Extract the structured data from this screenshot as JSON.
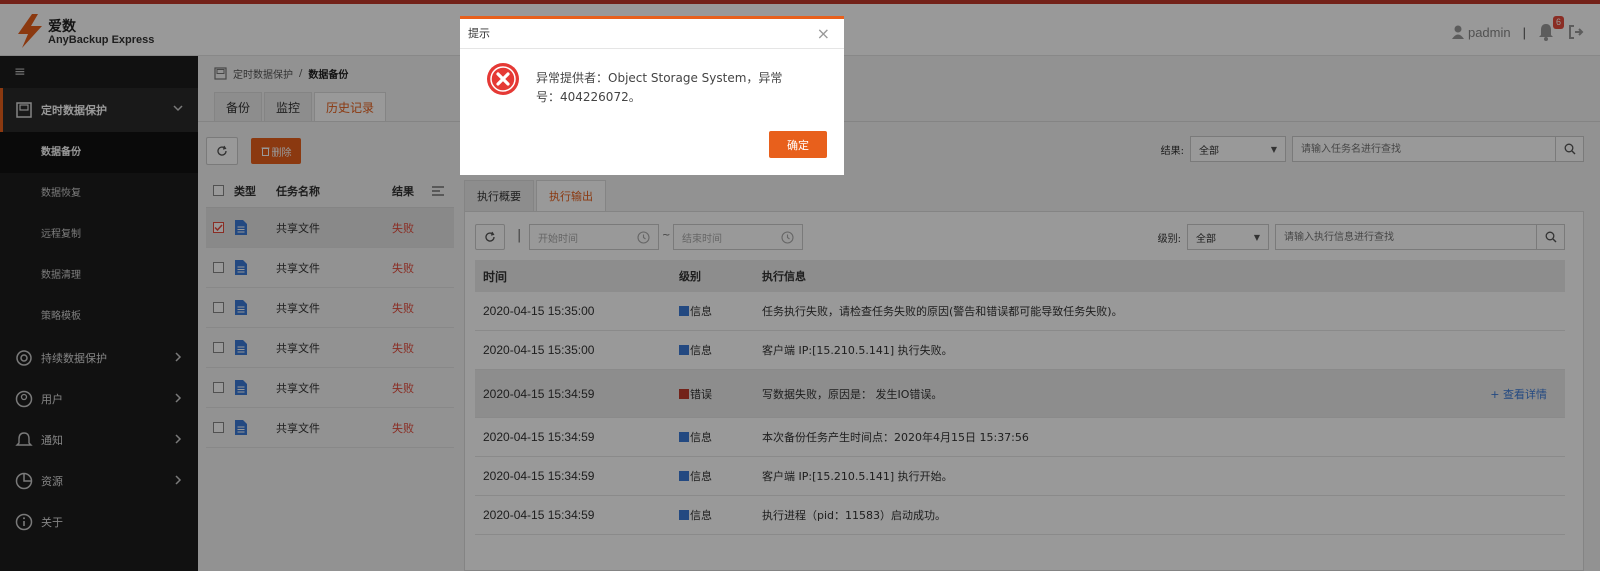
{
  "header": {
    "brand_cn": "爱数",
    "brand_en": "AnyBackup Express",
    "username": "padmin",
    "separator": "|",
    "notification_count": "6"
  },
  "sidebar": {
    "active_group": {
      "label": "定时数据保护",
      "icon": "backup-icon"
    },
    "sub_items": [
      {
        "label": "数据备份",
        "active": true
      },
      {
        "label": "数据恢复"
      },
      {
        "label": "远程复制"
      },
      {
        "label": "数据清理"
      },
      {
        "label": "策略模板"
      }
    ],
    "groups": [
      {
        "label": "持续数据保护",
        "icon": "continuous-protect-icon"
      },
      {
        "label": "用户",
        "icon": "user-icon"
      },
      {
        "label": "通知",
        "icon": "bell-icon"
      },
      {
        "label": "资源",
        "icon": "pie-chart-icon"
      },
      {
        "label": "关于",
        "icon": "info-icon"
      }
    ]
  },
  "breadcrumb": {
    "parent": "定时数据保护",
    "separator": "/",
    "current": "数据备份"
  },
  "tabs": [
    "备份",
    "监控",
    "历史记录"
  ],
  "toolbar": {
    "delete_label": "删除"
  },
  "filter": {
    "result_label": "结果:",
    "result_value": "全部",
    "search_placeholder": "请输入任务名进行查找"
  },
  "job_list": {
    "headers": {
      "type": "类型",
      "name": "任务名称",
      "result": "结果"
    },
    "rows": [
      {
        "name": "共享文件",
        "result": "失败",
        "checked": true
      },
      {
        "name": "共享文件",
        "result": "失败",
        "checked": false
      },
      {
        "name": "共享文件",
        "result": "失败",
        "checked": false
      },
      {
        "name": "共享文件",
        "result": "失败",
        "checked": false
      },
      {
        "name": "共享文件",
        "result": "失败",
        "checked": false
      },
      {
        "name": "共享文件",
        "result": "失败",
        "checked": false
      }
    ]
  },
  "detail": {
    "tabs": [
      "执行概要",
      "执行输出"
    ],
    "pipe": "|",
    "tilde": "~",
    "start_placeholder": "开始时间",
    "end_placeholder": "结束时间",
    "level_label": "级别:",
    "level_value": "全部",
    "search_placeholder": "请输入执行信息进行查找",
    "headers": {
      "time": "时间",
      "level": "级别",
      "message": "执行信息"
    },
    "rows": [
      {
        "time": "2020-04-15 15:35:00",
        "level": "信息",
        "level_color": "#3b7ad8",
        "message": "任务执行失败，请检查任务失败的原因(警告和错误都可能导致任务失败)。"
      },
      {
        "time": "2020-04-15 15:35:00",
        "level": "信息",
        "level_color": "#3b7ad8",
        "message": "客户端 IP:[15.210.5.141] 执行失败。"
      },
      {
        "time": "2020-04-15 15:34:59",
        "level": "错误",
        "level_color": "#c0392b",
        "message": "写数据失败，原因是： 发生IO错误。",
        "link": "+ 查看详情"
      },
      {
        "time": "2020-04-15 15:34:59",
        "level": "信息",
        "level_color": "#3b7ad8",
        "message": "本次备份任务产生时间点：2020年4月15日 15:37:56"
      },
      {
        "time": "2020-04-15 15:34:59",
        "level": "信息",
        "level_color": "#3b7ad8",
        "message": "客户端 IP:[15.210.5.141] 执行开始。"
      },
      {
        "time": "2020-04-15 15:34:59",
        "level": "信息",
        "level_color": "#3b7ad8",
        "message": "执行进程（pid：11583）启动成功。"
      }
    ]
  },
  "modal": {
    "title": "提示",
    "close": "×",
    "message": "异常提供者：Object Storage System，异常号：404226072。",
    "ok_label": "确定"
  },
  "colors": {
    "accent": "#e8601c",
    "error": "#e74c3c",
    "info": "#3b7ad8"
  }
}
